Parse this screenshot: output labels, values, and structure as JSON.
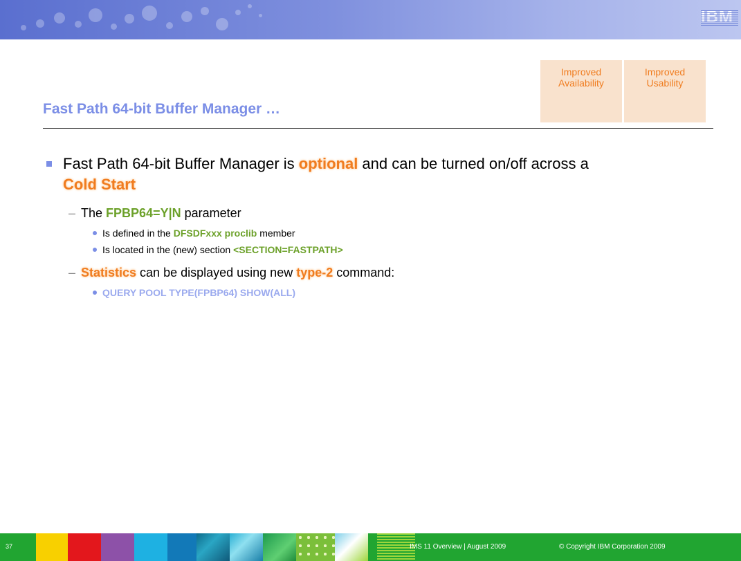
{
  "header": {
    "logo_text": "IBM"
  },
  "tags": [
    {
      "line1": "Improved",
      "line2": "Availability"
    },
    {
      "line1": "Improved",
      "line2": "Usability"
    }
  ],
  "title": "Fast Path 64-bit Buffer Manager …",
  "bullets": {
    "b1_part1": "Fast Path 64-bit Buffer Manager is ",
    "b1_hl1": "optional",
    "b1_part2": " and can be turned on/off across a",
    "b1_hl2": "Cold Start",
    "sub1_part1": "The ",
    "sub1_hl": "FPBP64=Y|N",
    "sub1_part2": " parameter",
    "sub1a_part1": "Is defined in the ",
    "sub1a_hl": "DFSDFxxx proclib",
    "sub1a_part2": " member",
    "sub1b_part1": "Is located in the (new) section ",
    "sub1b_hl": "<SECTION=FASTPATH>",
    "sub2_hl1": "Statistics",
    "sub2_part1": " can be displayed using new ",
    "sub2_hl2": "type-2",
    "sub2_part2": " command:",
    "sub2a": "QUERY POOL TYPE(FPBP64) SHOW(ALL)"
  },
  "footer": {
    "page_number": "37",
    "doc_info": "IMS 11 Overview  |  August 2009",
    "copyright": "© Copyright IBM Corporation 2009",
    "background_color": "#21a531"
  }
}
